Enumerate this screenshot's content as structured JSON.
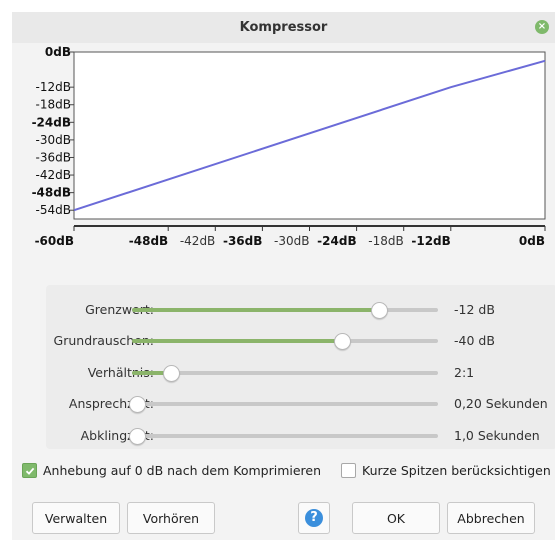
{
  "window": {
    "title": "Kompressor"
  },
  "graph": {
    "y_labels": [
      "0dB",
      "-12dB",
      "-18dB",
      "-24dB",
      "-30dB",
      "-36dB",
      "-42dB",
      "-48dB",
      "-54dB"
    ],
    "y_bold": [
      true,
      false,
      false,
      true,
      false,
      false,
      false,
      true,
      false
    ],
    "x_labels": [
      "-60dB",
      "-48dB",
      "-42dB",
      "-36dB",
      "-30dB",
      "-24dB",
      "-18dB",
      "-12dB",
      "0dB"
    ],
    "x_bold": [
      true,
      true,
      false,
      true,
      false,
      true,
      false,
      true,
      true
    ],
    "line_color": "#6b6bd8"
  },
  "chart_data": {
    "type": "line",
    "x": [
      -60,
      -12,
      0
    ],
    "series": [
      {
        "values": [
          -54,
          -12,
          -3
        ]
      }
    ],
    "xlim": [
      -60,
      0
    ],
    "ylim": [
      -57,
      0
    ]
  },
  "sliders": [
    {
      "label": "Grenzwert:",
      "value_text": "-12 dB",
      "fraction": 0.79
    },
    {
      "label": "Grundrauschen:",
      "value_text": "-40 dB",
      "fraction": 0.67
    },
    {
      "label": "Verhältnis:",
      "value_text": "2:1",
      "fraction": 0.11
    },
    {
      "label": "Ansprechzeit:",
      "value_text": "0,20 Sekunden",
      "fraction": 0.0
    },
    {
      "label": "Abklingzeit:",
      "value_text": "1,0 Sekunden",
      "fraction": 0.0
    }
  ],
  "checkboxes": {
    "makeup": {
      "label": "Anhebung auf 0 dB nach dem Komprimieren",
      "checked": true
    },
    "peaks": {
      "label": "Kurze Spitzen berücksichtigen",
      "checked": false
    }
  },
  "buttons": {
    "manage": "Verwalten",
    "preview": "Vorhören",
    "help": "?",
    "ok": "OK",
    "cancel": "Abbrechen"
  },
  "colors": {
    "accent_green": "#8bb46a",
    "help_blue": "#3b8fdc"
  }
}
